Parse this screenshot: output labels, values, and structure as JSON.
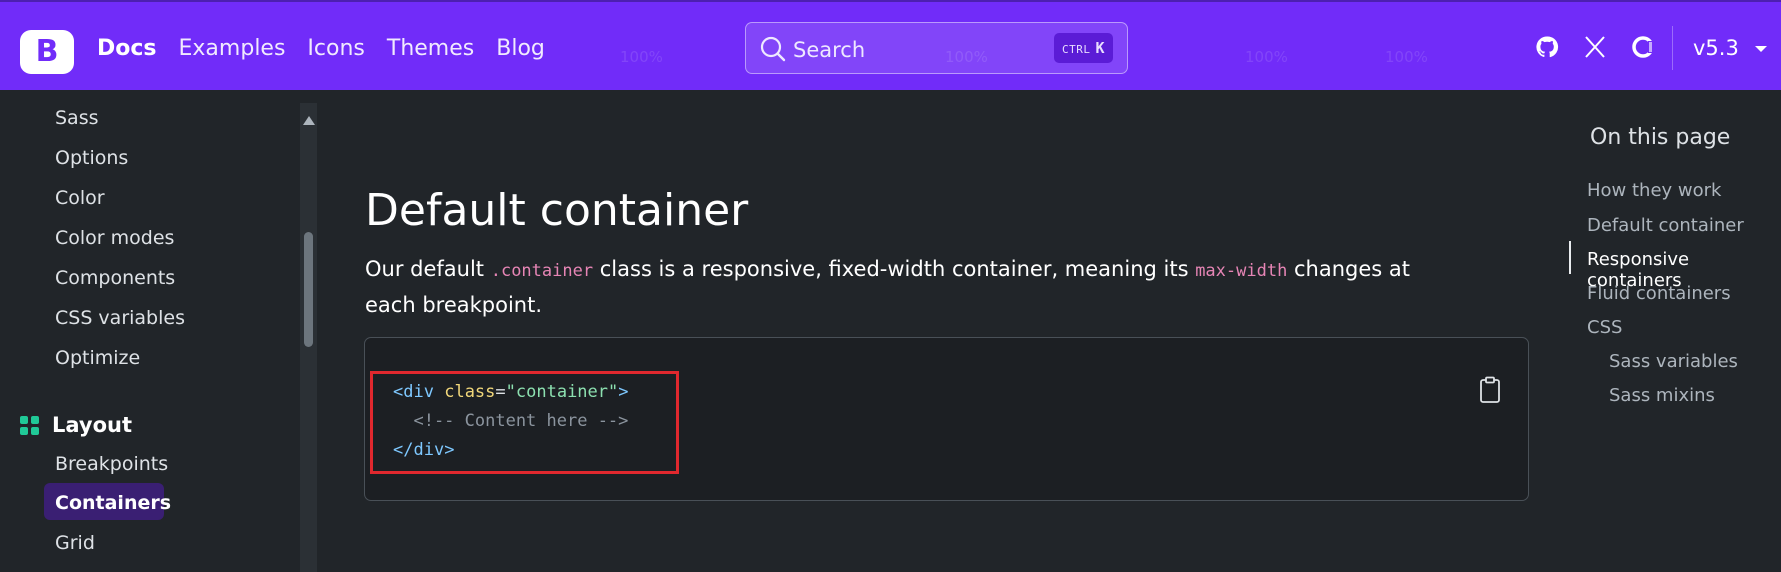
{
  "navbar": {
    "brand": "B",
    "links": [
      "Docs",
      "Examples",
      "Icons",
      "Themes",
      "Blog"
    ],
    "search_placeholder": "Search",
    "search_shortcut_mod": "CTRL",
    "search_shortcut_key": "K",
    "version": "v5.3",
    "icons": [
      "github-icon",
      "x-twitter-icon",
      "opencollective-icon"
    ],
    "watermarks": [
      "100%",
      "100%",
      "100%",
      "100%"
    ]
  },
  "sidebar": {
    "items_top": [
      "Sass",
      "Options",
      "Color",
      "Color modes",
      "Components",
      "CSS variables",
      "Optimize"
    ],
    "group_label": "Layout",
    "group_items": [
      "Breakpoints",
      "Containers",
      "Grid"
    ],
    "active_item": "Containers"
  },
  "main": {
    "heading": "Default container",
    "para_1": "Our default ",
    "para_code_1": ".container",
    "para_2": " class is a responsive, fixed-width container, meaning its ",
    "para_code_2": "max-width",
    "para_3": " changes at each breakpoint.",
    "code": {
      "line1_open": "<",
      "line1_tag": "div",
      "line1_attr": "class",
      "line1_eq": "=",
      "line1_val": "\"container\"",
      "line1_close": ">",
      "line2": "  <!-- Content here -->",
      "line3_open": "</",
      "line3_tag": "div",
      "line3_close": ">"
    }
  },
  "toc": {
    "title": "On this page",
    "items": [
      "How they work",
      "Default container",
      "Responsive containers",
      "Fluid containers",
      "CSS",
      "Sass variables",
      "Sass mixins"
    ],
    "active": "Responsive containers"
  },
  "colors": {
    "navbar": "#712cf9",
    "background": "#212529",
    "highlight": "#e0282e"
  }
}
